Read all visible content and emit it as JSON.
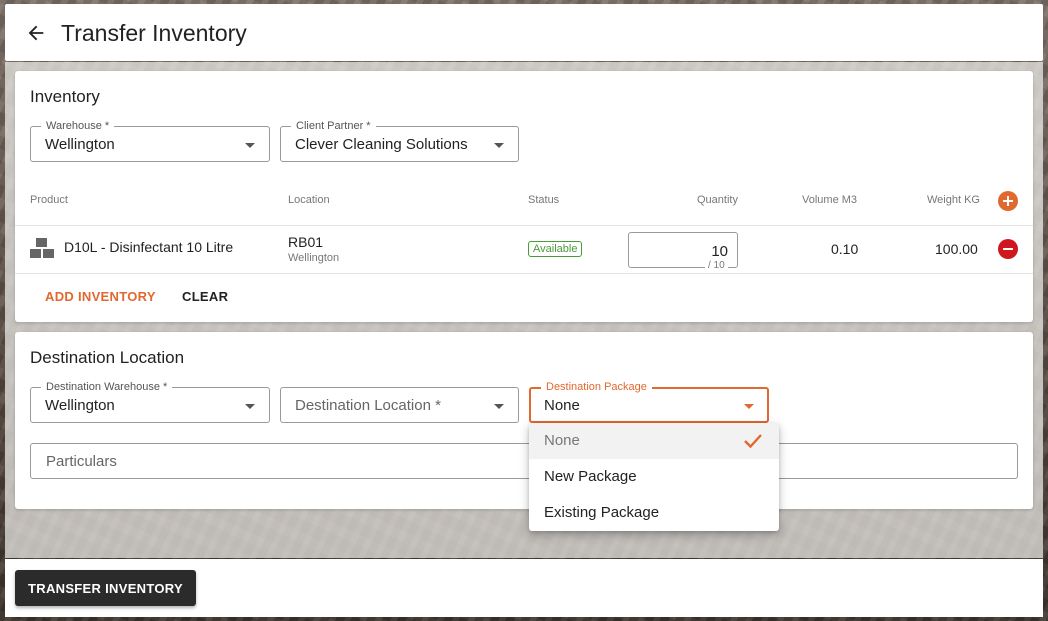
{
  "header": {
    "title": "Transfer Inventory",
    "back_icon": "arrow-left-icon"
  },
  "inventory": {
    "title": "Inventory",
    "warehouse": {
      "label": "Warehouse *",
      "value": "Wellington"
    },
    "client_partner": {
      "label": "Client Partner *",
      "value": "Clever Cleaning Solutions"
    },
    "columns": [
      "Product",
      "Location",
      "Status",
      "Quantity",
      "Volume M3",
      "Weight KG"
    ],
    "rows": [
      {
        "product": "D10L - Disinfectant 10 Litre",
        "location": "RB01",
        "location_sub": "Wellington",
        "status": "Available",
        "quantity": "10",
        "quantity_max": "/ 10",
        "volume": "0.10",
        "weight": "100.00"
      }
    ],
    "add_inventory_label": "ADD INVENTORY",
    "clear_label": "CLEAR"
  },
  "destination": {
    "title": "Destination Location",
    "warehouse": {
      "label": "Destination Warehouse *",
      "value": "Wellington"
    },
    "location": {
      "placeholder": "Destination Location *"
    },
    "package": {
      "label": "Destination Package",
      "value": "None",
      "options": [
        "None",
        "New Package",
        "Existing Package"
      ],
      "selected_index": 0
    },
    "particulars_placeholder": "Particulars"
  },
  "footer": {
    "submit_label": "TRANSFER INVENTORY"
  },
  "colors": {
    "accent": "#e0692f",
    "danger": "#d0171e",
    "success": "#4a9a3a",
    "primary_button": "#2b2b2b"
  }
}
